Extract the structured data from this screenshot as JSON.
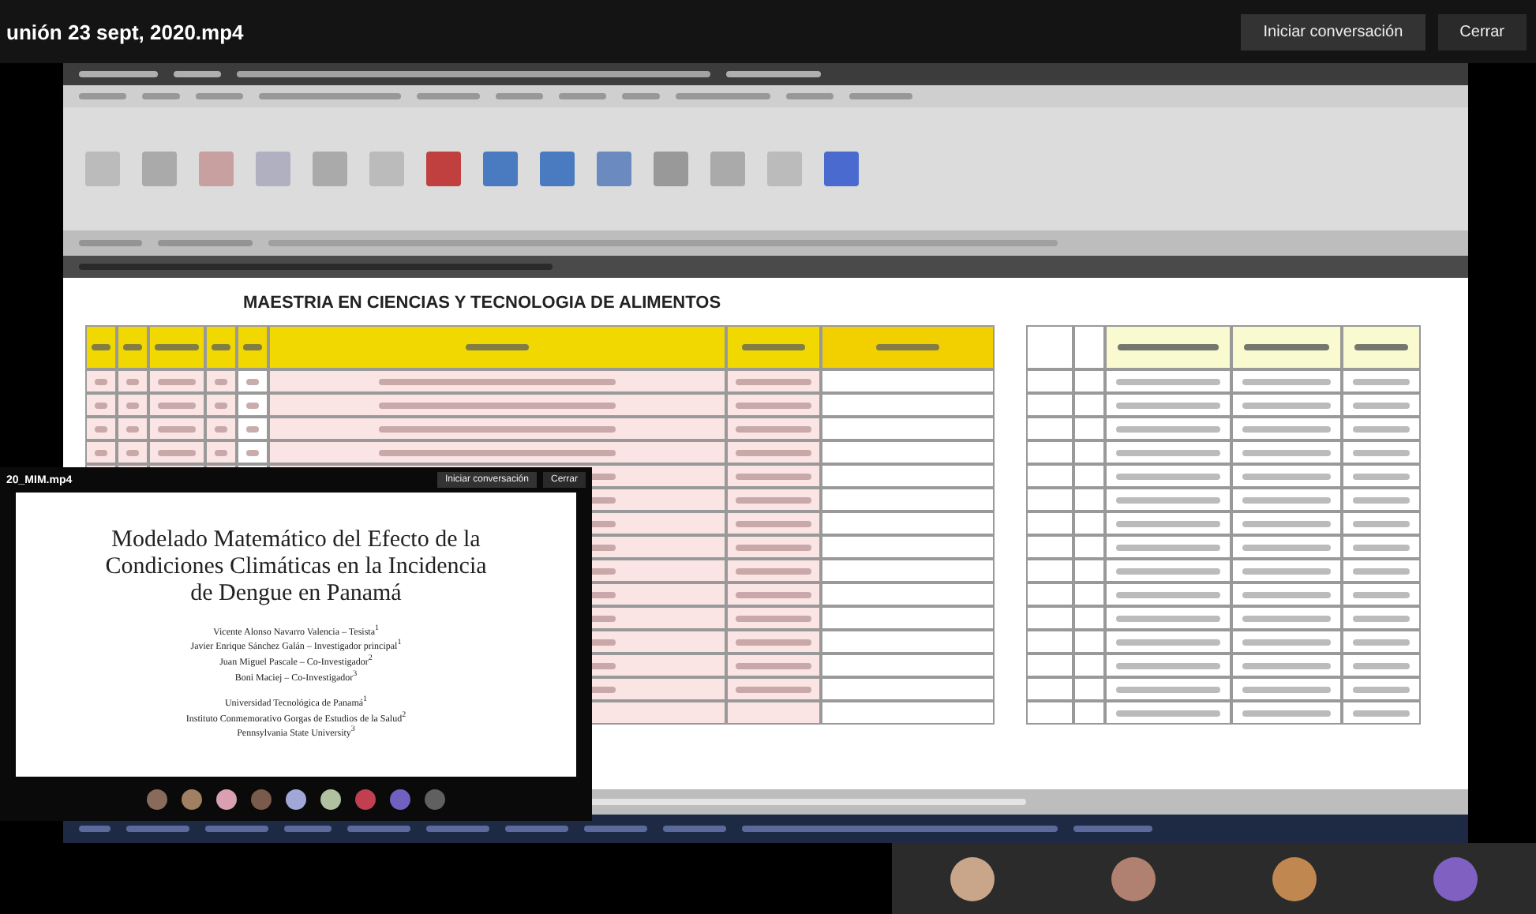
{
  "window": {
    "title": "unión 23 sept, 2020.mp4",
    "buttons": [
      "Iniciar conversación",
      "Cerrar"
    ]
  },
  "sheet": {
    "title": "MAESTRIA EN CIENCIAS Y TECNOLOGIA DE ALIMENTOS"
  },
  "inset": {
    "title": "20_MIM.mp4",
    "buttons": [
      "Iniciar conversación",
      "Cerrar"
    ],
    "slide": {
      "title": "Modelado Matemático del Efecto de la Condiciones Climáticas en la Incidencia de Dengue en Panamá",
      "authors": [
        "Vicente Alonso Navarro Valencia – Tesista$^{1}$",
        "Javier Enrique Sánchez Galán – Investigador principal$^{1}$",
        "Juan Miguel Pascale – Co-Investigador$^{2}$",
        "Boni Maciej – Co-Investigador$^{3}$"
      ],
      "affiliations": [
        "Universidad Tecnológica de Panamá$^{1}$",
        "Instituto Conmemorativo Gorgas de Estudios de la Salud$^{2}$",
        "Pennsylvania State University$^{3}$"
      ]
    }
  }
}
